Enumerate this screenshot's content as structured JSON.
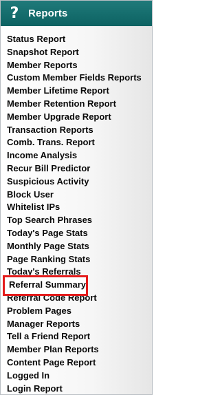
{
  "header": {
    "title": "Reports",
    "icon": "question-mark-icon",
    "icon_glyph": "?",
    "background_color": "#0d6262"
  },
  "highlight": {
    "color": "#e41b1b",
    "item": "Referral Summary"
  },
  "menu": {
    "items": [
      {
        "label": "Status Report"
      },
      {
        "label": "Snapshot Report"
      },
      {
        "label": "Member Reports"
      },
      {
        "label": "Custom Member Fields Reports"
      },
      {
        "label": "Member Lifetime Report"
      },
      {
        "label": "Member Retention Report"
      },
      {
        "label": "Member Upgrade Report"
      },
      {
        "label": "Transaction Reports"
      },
      {
        "label": "Comb. Trans. Report"
      },
      {
        "label": "Income Analysis"
      },
      {
        "label": "Recur Bill Predictor"
      },
      {
        "label": "Suspicious Activity"
      },
      {
        "label": "Block User"
      },
      {
        "label": "Whitelist IPs"
      },
      {
        "label": "Top Search Phrases"
      },
      {
        "label": "Today's Page Stats"
      },
      {
        "label": "Monthly Page Stats"
      },
      {
        "label": "Page Ranking Stats"
      },
      {
        "label": "Today's Referrals"
      },
      {
        "label": "Referral Summary"
      },
      {
        "label": "Referral Code Report"
      },
      {
        "label": "Problem Pages"
      },
      {
        "label": "Manager Reports"
      },
      {
        "label": "Tell a Friend Report"
      },
      {
        "label": "Member Plan Reports"
      },
      {
        "label": "Content Page Report"
      },
      {
        "label": "Logged In"
      },
      {
        "label": "Login Report"
      }
    ]
  }
}
